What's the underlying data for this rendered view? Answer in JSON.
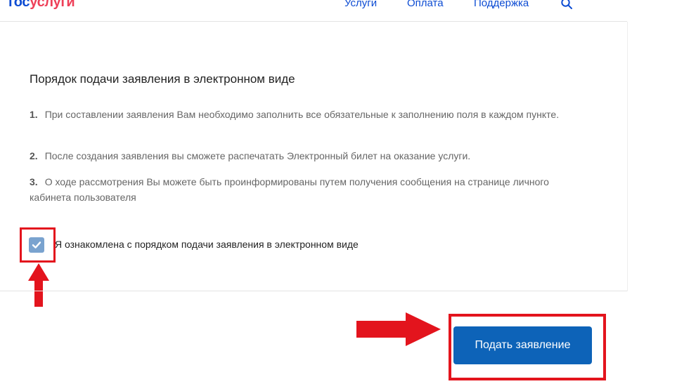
{
  "header": {
    "logo_part1": "гос",
    "logo_part2": "услуги",
    "nav": [
      "Услуги",
      "Оплата",
      "Поддержка"
    ]
  },
  "main": {
    "title": "Порядок подачи заявления в электронном виде",
    "steps": [
      {
        "num": "1.",
        "text": "При составлении заявления Вам необходимо заполнить все обязательные к заполнению поля в каждом пункте."
      },
      {
        "num": "2.",
        "text": "После создания заявления вы сможете распечатать Электронный билет на оказание услуги."
      },
      {
        "num": "3.",
        "text": "О ходе рассмотрения Вы можете быть проинформированы путем получения сообщения на странице личного кабинета пользователя"
      }
    ],
    "agree_checked": true,
    "agree_label": "Я ознакомлена с порядком подачи заявления в электронном виде",
    "submit_label": "Подать заявление"
  },
  "colors": {
    "brand_blue": "#0d4cd3",
    "brand_red": "#ee3f58",
    "button": "#0d63b8",
    "highlight": "#e3141d",
    "checkbox": "#7aa3cf"
  },
  "icons": {
    "search": "search-icon",
    "checkmark": "checkmark-icon",
    "annotation_arrow_up": "arrow-up-icon",
    "annotation_arrow_right": "arrow-right-icon"
  }
}
